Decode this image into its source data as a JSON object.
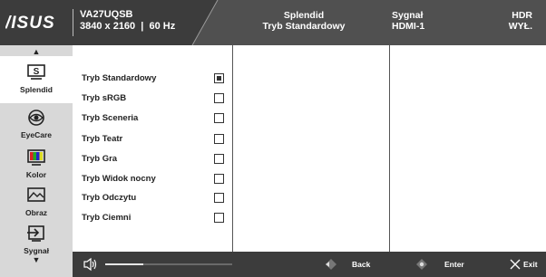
{
  "header": {
    "brand": "ASUS",
    "model": "VA27UQSB",
    "resolution": "3840 x 2160",
    "refresh": "60 Hz",
    "splendid_title": "Splendid",
    "splendid_value": "Tryb Standardowy",
    "signal_title": "Sygnał",
    "signal_value": "HDMI-1",
    "hdr_title": "HDR",
    "hdr_value": "WYŁ."
  },
  "sidebar": {
    "items": [
      {
        "label": "Splendid",
        "icon": "splendid-icon",
        "active": true
      },
      {
        "label": "EyeCare",
        "icon": "eye-icon",
        "active": false
      },
      {
        "label": "Kolor",
        "icon": "color-bars-icon",
        "active": false
      },
      {
        "label": "Obraz",
        "icon": "image-icon",
        "active": false
      },
      {
        "label": "Sygnał",
        "icon": "input-signal-icon",
        "active": false
      }
    ]
  },
  "menu": {
    "items": [
      {
        "label": "Tryb Standardowy",
        "checked": true
      },
      {
        "label": "Tryb sRGB",
        "checked": false
      },
      {
        "label": "Tryb Sceneria",
        "checked": false
      },
      {
        "label": "Tryb Teatr",
        "checked": false
      },
      {
        "label": "Tryb Gra",
        "checked": false
      },
      {
        "label": "Tryb Widok nocny",
        "checked": false
      },
      {
        "label": "Tryb Odczytu",
        "checked": false
      },
      {
        "label": "Tryb Ciemni",
        "checked": false
      }
    ]
  },
  "footer": {
    "volume_level": 0.3,
    "back_label": "Back",
    "enter_label": "Enter",
    "exit_label": "Exit"
  }
}
